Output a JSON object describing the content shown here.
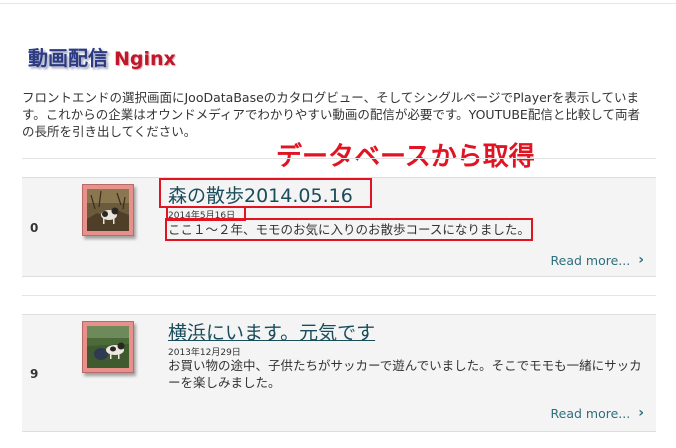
{
  "page": {
    "title_jp": "動画配信",
    "title_en": "Nginx",
    "intro": "フロントエンドの選択画面にJooDataBaseのカタログビュー、そしてシングルページでPlayerを表示しています。これからの企業はオウンドメディアでわかりやすい動画の配信が必要です。YOUTUBE配信と比較して両者の長所を引き出してください。",
    "annotation": "データベースから取得"
  },
  "items": [
    {
      "number": "0",
      "title": "森の散歩2014.05.16",
      "date": "2014年5月16日",
      "description": "ここ１～２年、モモのお気に入りのお散歩コースになりました。",
      "read_more": "Read more..."
    },
    {
      "number": "9",
      "title": "横浜にいます。元気です",
      "date": "2013年12月29日",
      "description": "お買い物の途中、子供たちがサッカーで遊んでいました。そこでモモも一緒にサッカーを楽しみました。",
      "read_more": "Read more..."
    }
  ],
  "colors": {
    "annotation_red": "#e01422",
    "title_teal": "#1a4d5c",
    "link_teal": "#2e6f7d",
    "thumb_border": "#e8908c"
  }
}
